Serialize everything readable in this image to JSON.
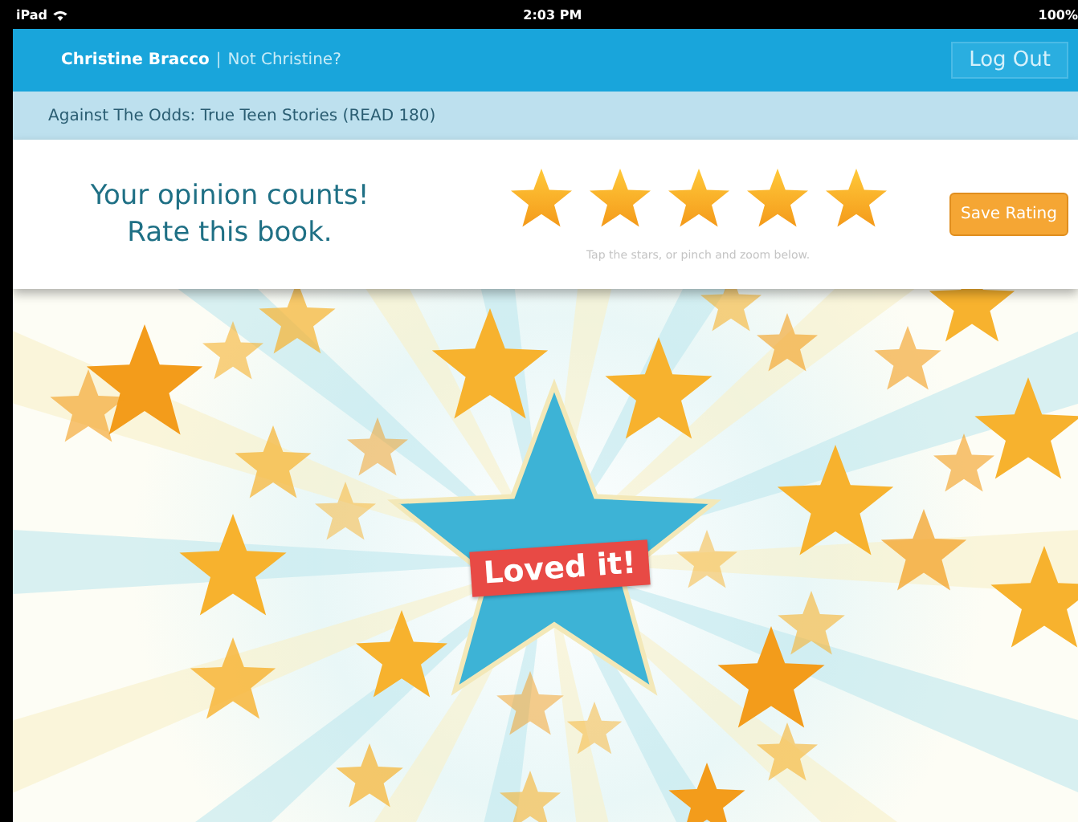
{
  "status_bar": {
    "device": "iPad",
    "time": "2:03 PM",
    "battery": "100%"
  },
  "header": {
    "user": "Christine Bracco",
    "separator": "|",
    "switch_link": "Not Christine?",
    "logout": "Log Out"
  },
  "book_bar": {
    "title": "Against The Odds: True Teen Stories (READ 180)"
  },
  "rating": {
    "prompt_line_1": "Your opinion counts!",
    "prompt_line_2": "Rate this book.",
    "stars": 5,
    "hint": "Tap the stars, or pinch and zoom below.",
    "save": "Save Rating"
  },
  "artwork": {
    "banner": "Loved it!"
  }
}
